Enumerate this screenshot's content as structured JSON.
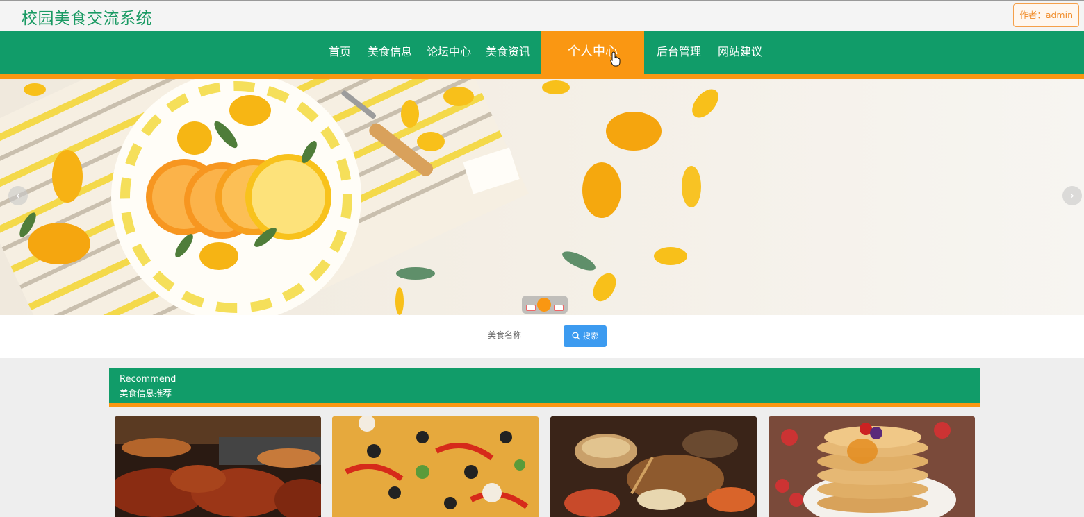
{
  "header": {
    "site_title": "校园美食交流系统",
    "author_label": "作者：admin"
  },
  "nav": {
    "items": [
      {
        "label": "首页"
      },
      {
        "label": "美食信息"
      },
      {
        "label": "论坛中心"
      },
      {
        "label": "美食资讯"
      },
      {
        "label": "个人中心",
        "active": true
      },
      {
        "label": "后台管理"
      },
      {
        "label": "网站建议"
      }
    ]
  },
  "carousel": {
    "prev_icon": "chevron-left-icon",
    "next_icon": "chevron-right-icon",
    "prev_glyph": "‹",
    "next_glyph": "›"
  },
  "search": {
    "field_label": "美食名称",
    "button_label": "搜索"
  },
  "recommend": {
    "title_en": "Recommend",
    "title_cn": "美食信息推荐"
  },
  "cards": [
    {
      "image": "grilled-meat-photo"
    },
    {
      "image": "pizza-photo"
    },
    {
      "image": "seafood-feast-photo"
    },
    {
      "image": "pancakes-photo"
    }
  ],
  "colors": {
    "primary_green": "#119c69",
    "accent_orange": "#fa9712",
    "search_blue": "#3c9bf0"
  }
}
